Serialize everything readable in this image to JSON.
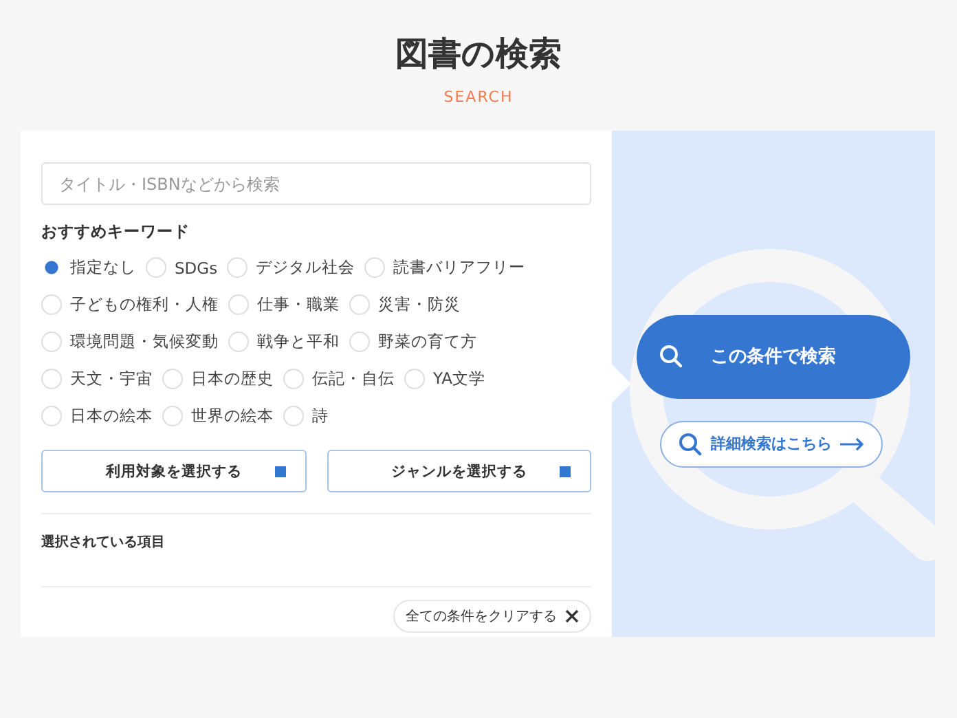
{
  "title": "図書の検索",
  "subtitle": "SEARCH",
  "search": {
    "placeholder": "タイトル・ISBNなどから検索"
  },
  "keywords_heading": "おすすめキーワード",
  "keywords": [
    {
      "label": "指定なし",
      "selected": true
    },
    {
      "label": "SDGs",
      "selected": false
    },
    {
      "label": "デジタル社会",
      "selected": false
    },
    {
      "label": "読書バリアフリー",
      "selected": false
    },
    {
      "label": "子どもの権利・人権",
      "selected": false
    },
    {
      "label": "仕事・職業",
      "selected": false
    },
    {
      "label": "災害・防災",
      "selected": false
    },
    {
      "label": "環境問題・気候変動",
      "selected": false
    },
    {
      "label": "戦争と平和",
      "selected": false
    },
    {
      "label": "野菜の育て方",
      "selected": false
    },
    {
      "label": "天文・宇宙",
      "selected": false
    },
    {
      "label": "日本の歴史",
      "selected": false
    },
    {
      "label": "伝記・自伝",
      "selected": false
    },
    {
      "label": "YA文学",
      "selected": false
    },
    {
      "label": "日本の絵本",
      "selected": false
    },
    {
      "label": "世界の絵本",
      "selected": false
    },
    {
      "label": "詩",
      "selected": false
    }
  ],
  "select_buttons": [
    "利用対象を選択する",
    "ジャンルを選択する"
  ],
  "selected_items_heading": "選択されている項目",
  "clear_button": "全ての条件をクリアする",
  "search_button": "この条件で検索",
  "advanced_link": "詳細検索はこちら"
}
